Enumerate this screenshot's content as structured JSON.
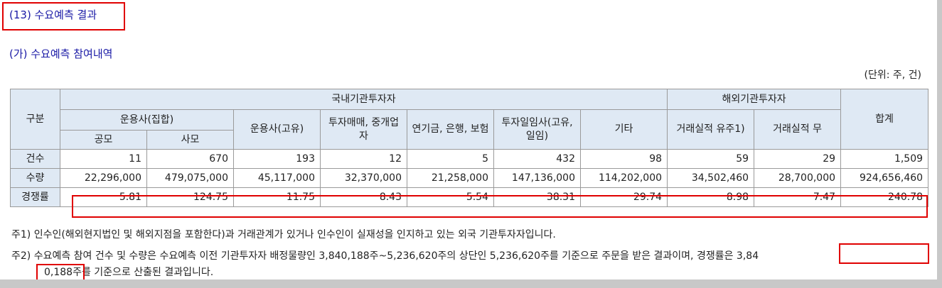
{
  "section_title": "(13) 수요예측 결과",
  "subsection_title": "(가) 수요예측 참여내역",
  "unit_label": "(단위: 주, 건)",
  "table": {
    "header": {
      "category": "구분",
      "domestic_group": "국내기관투자자",
      "foreign_group": "해외기관투자자",
      "total": "합계",
      "asset_mgmt_collective": "운용사(집합)",
      "public_offering": "공모",
      "private_offering": "사모",
      "asset_mgmt_proprietary": "운용사(고유)",
      "investment_brokerage": "투자매매, 중개업자",
      "pension_bank_insurance": "연기금, 은행, 보험",
      "investment_advisory": "투자일임사(고유, 일임)",
      "other": "기타",
      "with_track_record": "거래실적 유주1)",
      "without_track_record": "거래실적 무"
    },
    "rows": [
      {
        "label": "건수",
        "values": [
          "11",
          "670",
          "193",
          "12",
          "5",
          "432",
          "98",
          "59",
          "29",
          "1,509"
        ]
      },
      {
        "label": "수량",
        "values": [
          "22,296,000",
          "479,075,000",
          "45,117,000",
          "32,370,000",
          "21,258,000",
          "147,136,000",
          "114,202,000",
          "34,502,460",
          "28,700,000",
          "924,656,460"
        ]
      },
      {
        "label": "경쟁률",
        "values": [
          "5.81",
          "124.75",
          "11.75",
          "8.43",
          "5.54",
          "38.31",
          "29.74",
          "8.98",
          "7.47",
          "240.78"
        ]
      }
    ]
  },
  "notes": {
    "note1": "주1) 인수인(해외현지법인 및 해외지점을 포함한다)과 거래관계가 있거나 인수인이 실재성을 인지하고 있는 외국 기관투자자입니다.",
    "note2": "주2) 수요예측 참여 건수 및 수량은 수요예측 이전 기관투자자 배정물량인 3,840,188주~5,236,620주의 상단인 5,236,620주를 기준으로 주문을 받은 결과이며, 경쟁률은 3,84",
    "note3": "0,188주를 기준으로 산출된 결과입니다."
  },
  "colors": {
    "heading_text": "#1a1aa6",
    "header_fill": "#dfe9f4",
    "highlight_box": "#e00000"
  }
}
